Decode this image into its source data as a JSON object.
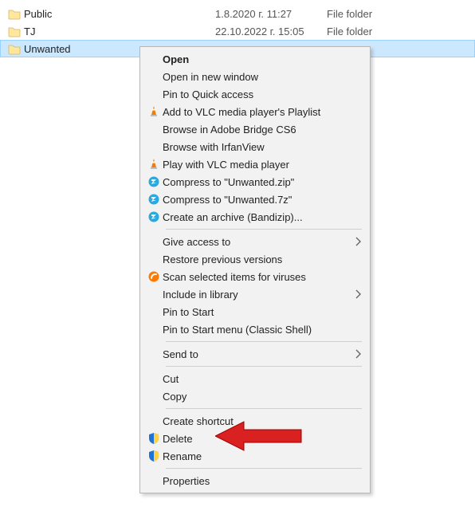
{
  "file_list": {
    "rows": [
      {
        "name": "Public",
        "date": "1.8.2020 г. 11:27",
        "type": "File folder",
        "selected": false
      },
      {
        "name": "TJ",
        "date": "22.10.2022 г. 15:05",
        "type": "File folder",
        "selected": false
      },
      {
        "name": "Unwanted",
        "date": "",
        "type": "",
        "selected": true
      }
    ]
  },
  "context_menu": {
    "groups": [
      [
        {
          "label": "Open",
          "bold": true,
          "icon": "none",
          "submenu": false
        },
        {
          "label": "Open in new window",
          "icon": "none",
          "submenu": false
        },
        {
          "label": "Pin to Quick access",
          "icon": "none",
          "submenu": false
        },
        {
          "label": "Add to VLC media player's Playlist",
          "icon": "vlc",
          "submenu": false
        },
        {
          "label": "Browse in Adobe Bridge CS6",
          "icon": "none",
          "submenu": false
        },
        {
          "label": "Browse with IrfanView",
          "icon": "none",
          "submenu": false
        },
        {
          "label": "Play with VLC media player",
          "icon": "vlc",
          "submenu": false
        },
        {
          "label": "Compress to \"Unwanted.zip\"",
          "icon": "bandizip",
          "submenu": false
        },
        {
          "label": "Compress to \"Unwanted.7z\"",
          "icon": "bandizip",
          "submenu": false
        },
        {
          "label": "Create an archive (Bandizip)...",
          "icon": "bandizip",
          "submenu": false
        }
      ],
      [
        {
          "label": "Give access to",
          "icon": "none",
          "submenu": true
        },
        {
          "label": "Restore previous versions",
          "icon": "none",
          "submenu": false
        },
        {
          "label": "Scan selected items for viruses",
          "icon": "avast",
          "submenu": false
        },
        {
          "label": "Include in library",
          "icon": "none",
          "submenu": true
        },
        {
          "label": "Pin to Start",
          "icon": "none",
          "submenu": false
        },
        {
          "label": "Pin to Start menu (Classic Shell)",
          "icon": "none",
          "submenu": false
        }
      ],
      [
        {
          "label": "Send to",
          "icon": "none",
          "submenu": true
        }
      ],
      [
        {
          "label": "Cut",
          "icon": "none",
          "submenu": false
        },
        {
          "label": "Copy",
          "icon": "none",
          "submenu": false
        }
      ],
      [
        {
          "label": "Create shortcut",
          "icon": "none",
          "submenu": false
        },
        {
          "label": "Delete",
          "icon": "uac",
          "submenu": false,
          "callout": true
        },
        {
          "label": "Rename",
          "icon": "uac",
          "submenu": false
        }
      ],
      [
        {
          "label": "Properties",
          "icon": "none",
          "submenu": false
        }
      ]
    ]
  }
}
